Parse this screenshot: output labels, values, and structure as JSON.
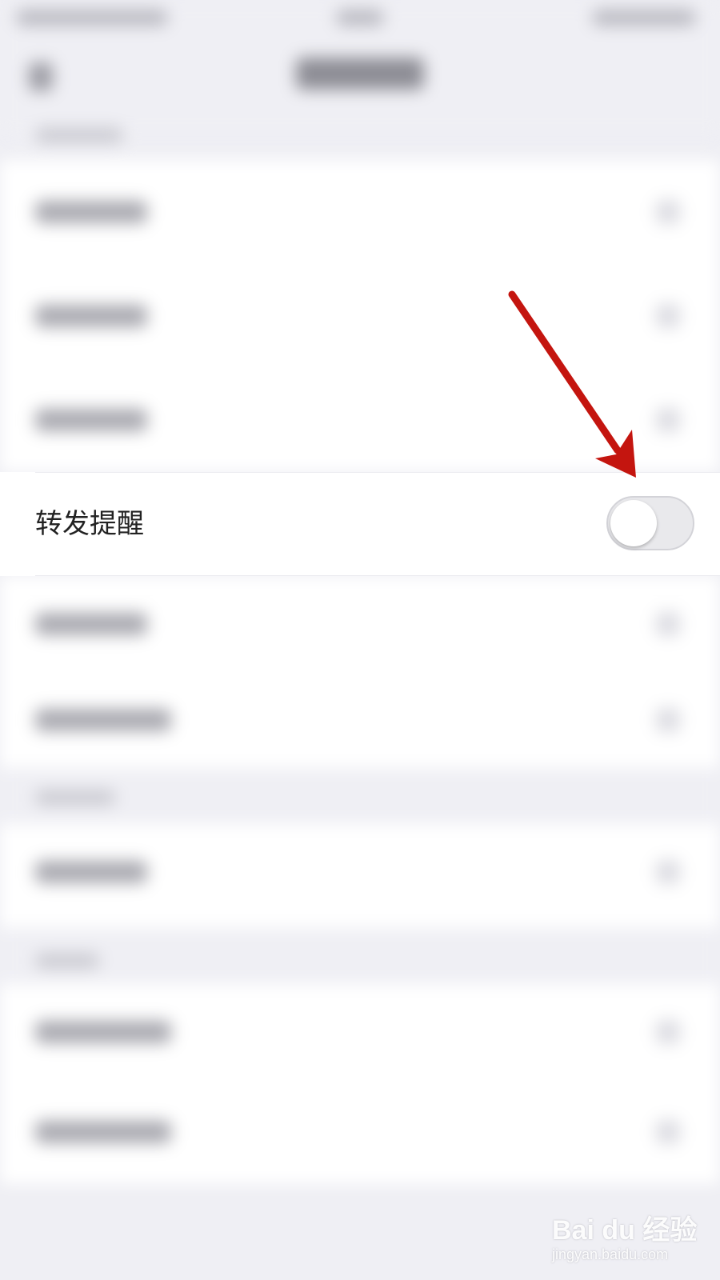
{
  "settings": {
    "highlighted_row": {
      "label": "转发提醒",
      "toggle_on": false
    }
  },
  "annotation": {
    "arrow_color": "#c4150f"
  },
  "watermark": {
    "logo_text": "Bai du 经验",
    "site": "jingyan.baidu.com"
  },
  "colors": {
    "background": "#efeff4",
    "row_background": "#ffffff",
    "toggle_off_track": "#e9e9ec"
  }
}
